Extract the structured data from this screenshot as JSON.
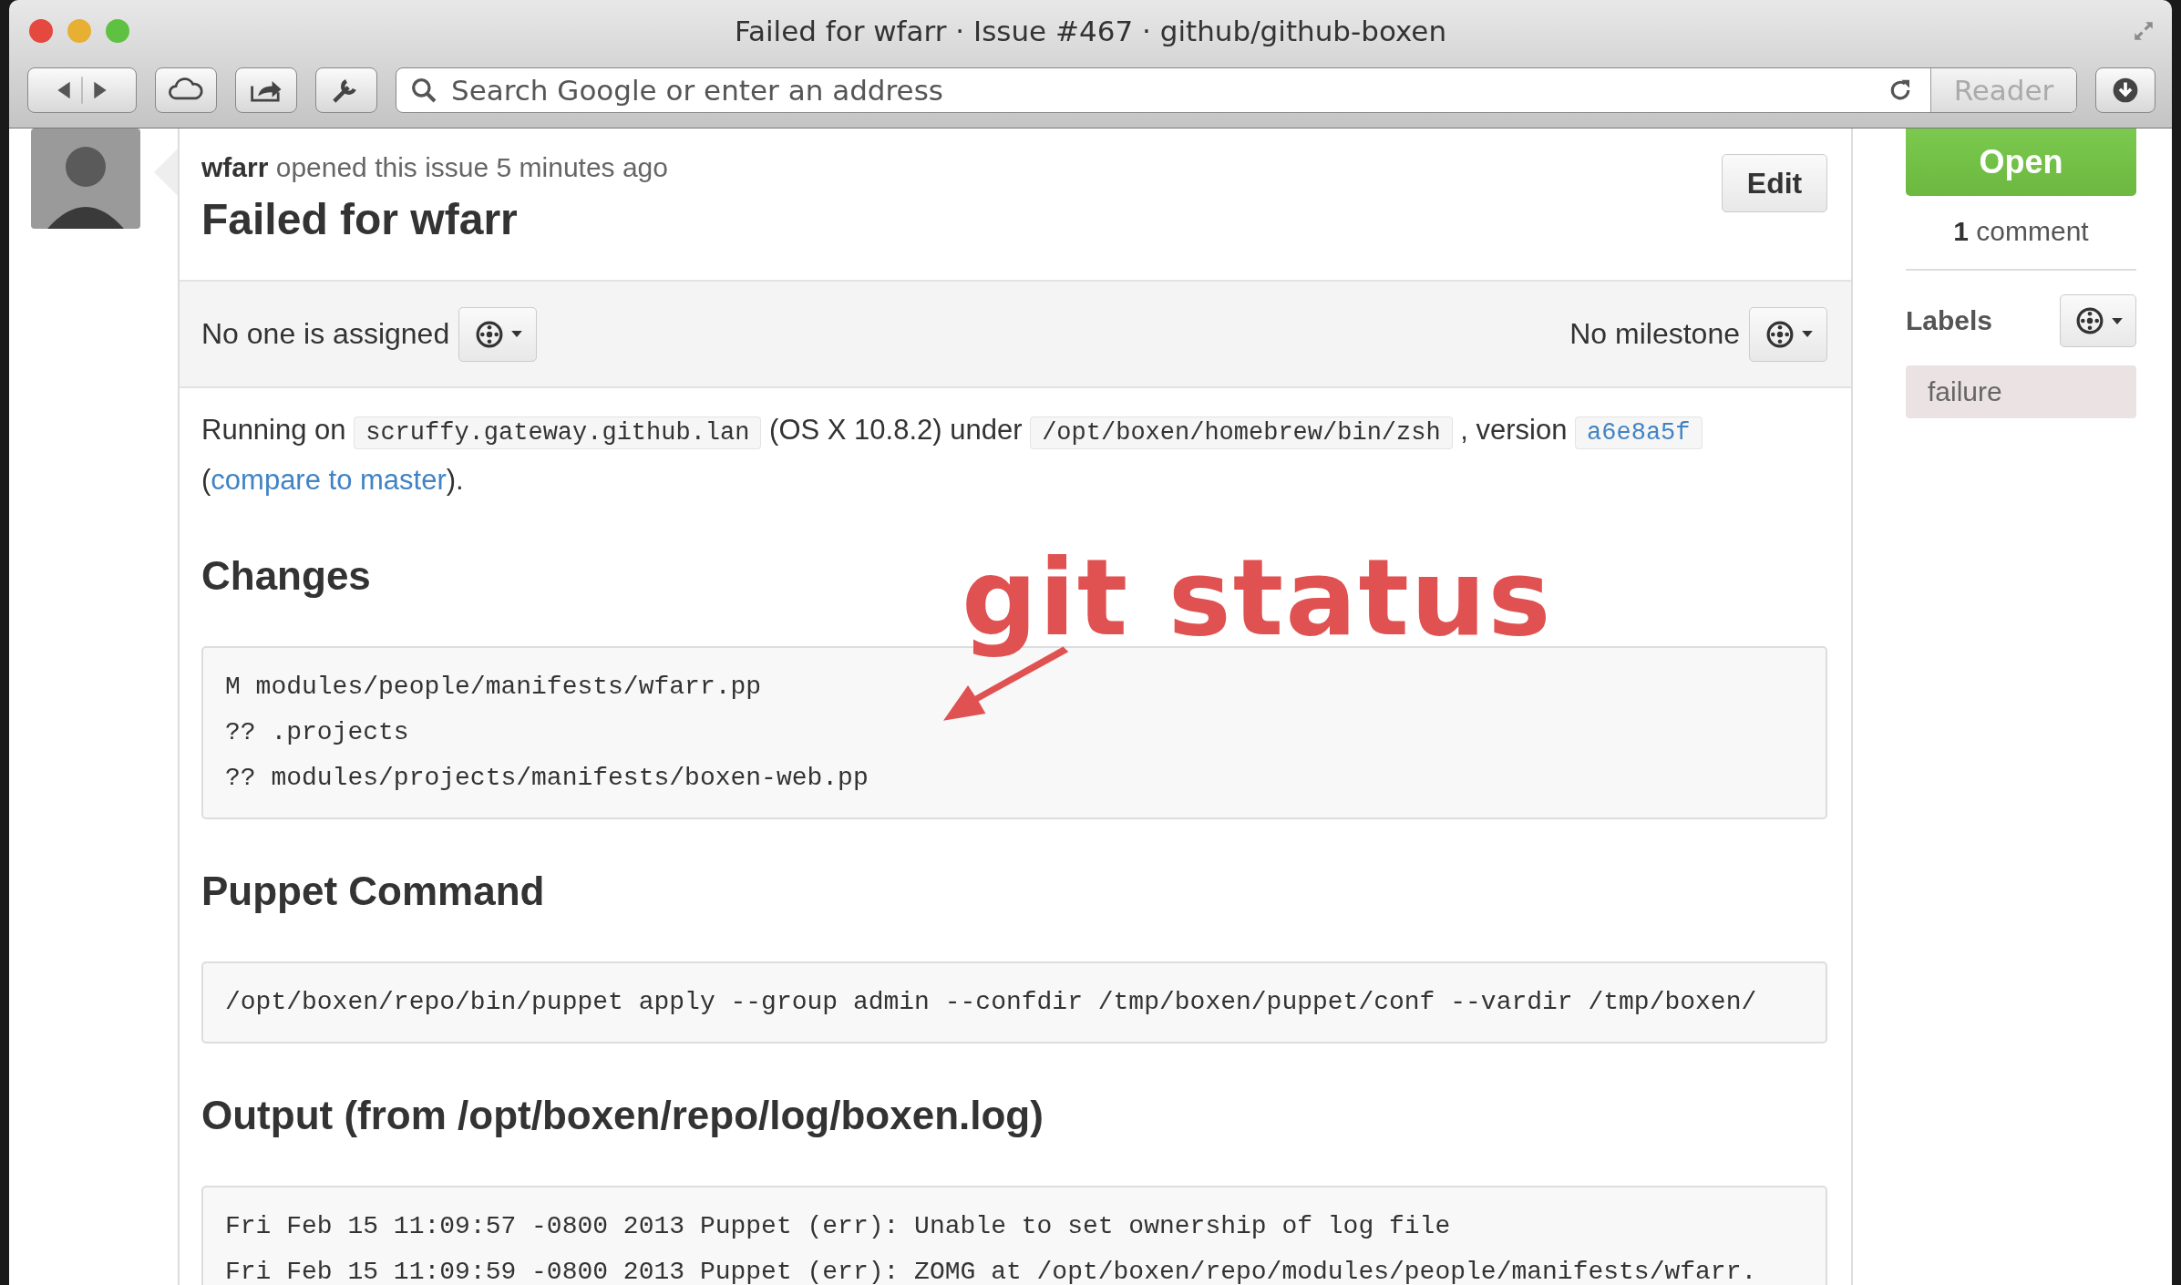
{
  "window": {
    "title": "Failed for wfarr · Issue #467 · github/github-boxen"
  },
  "toolbar": {
    "address_placeholder": "Search Google or enter an address",
    "reader": "Reader"
  },
  "issue": {
    "byline": "**wfarr** opened this issue 5 minutes ago",
    "title": "Failed for wfarr",
    "edit": "Edit"
  },
  "meta_bar": {
    "assignee": "No one is assigned",
    "milestone": "No milestone"
  },
  "intro": [
    {
      "kind": "text",
      "text": "Running on"
    },
    {
      "kind": "code",
      "text": "scruffy.gateway.github.lan"
    },
    {
      "kind": "text",
      "text": "(OS X 10.8.2) under"
    },
    {
      "kind": "code",
      "text": "/opt/boxen/homebrew/bin/zsh"
    },
    {
      "kind": "text",
      "text": ", version"
    },
    {
      "kind": "sha",
      "text": "a6e8a5f"
    },
    {
      "kind": "text",
      "text": "("
    },
    {
      "kind": "link",
      "text": "compare to master"
    },
    {
      "kind": "text",
      "text": ")."
    }
  ],
  "sections": [
    {
      "heading": "Changes",
      "lines": [
        "M modules/people/manifests/wfarr.pp",
        "?? .projects",
        "?? modules/projects/manifests/boxen-web.pp"
      ]
    },
    {
      "heading": "Puppet Command",
      "lines": [
        "/opt/boxen/repo/bin/puppet apply --group admin --confdir /tmp/boxen/puppet/conf --vardir /tmp/boxen/"
      ]
    },
    {
      "heading": "Output (from /opt/boxen/repo/log/boxen.log)",
      "lines": [
        "Fri Feb 15 11:09:57 -0800 2013 Puppet (err): Unable to set ownership of log file",
        "Fri Feb 15 11:09:59 -0800 2013 Puppet (err): ZOMG at /opt/boxen/repo/modules/people/manifests/wfarr."
      ]
    }
  ],
  "sidebar": {
    "state": "Open",
    "comments": "**1** comment",
    "labels_heading": "Labels",
    "labels": [
      {
        "name": "failure"
      }
    ]
  },
  "annotation": {
    "text": "git status"
  }
}
